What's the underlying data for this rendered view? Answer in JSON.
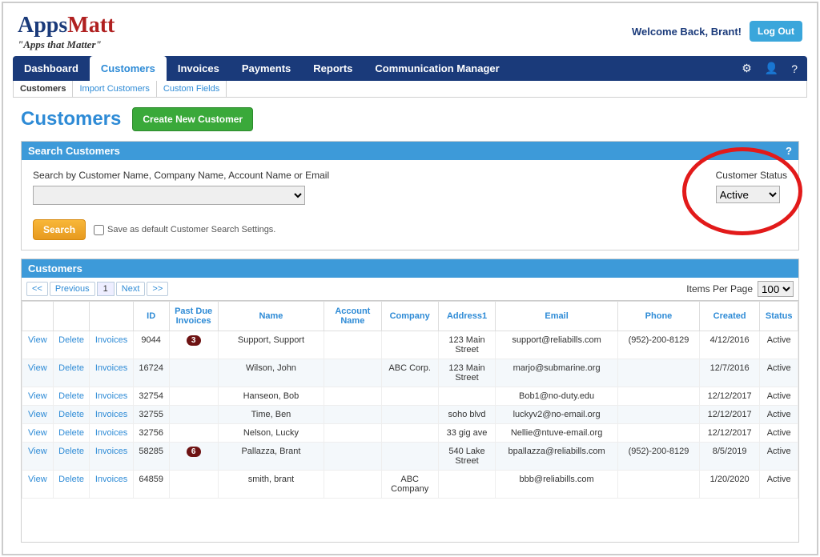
{
  "brand": {
    "apps": "Apps",
    "matt": "Matt",
    "tagline": "\"Apps that Matter\""
  },
  "header": {
    "welcome": "Welcome Back, Brant!",
    "logout": "Log Out"
  },
  "nav": {
    "items": [
      "Dashboard",
      "Customers",
      "Invoices",
      "Payments",
      "Reports",
      "Communication Manager"
    ],
    "active_index": 1
  },
  "subnav": {
    "items": [
      "Customers",
      "Import Customers",
      "Custom Fields"
    ],
    "active_index": 0
  },
  "page": {
    "title": "Customers",
    "create_btn": "Create New Customer"
  },
  "search_panel": {
    "title": "Search Customers",
    "help": "?",
    "field_label": "Search by Customer Name, Company Name, Account Name or Email",
    "status_label": "Customer Status",
    "status_value": "Active",
    "search_btn": "Search",
    "save_default": "Save as default Customer Search Settings."
  },
  "list_panel": {
    "title": "Customers",
    "pager": {
      "first": "<<",
      "prev": "Previous",
      "page": "1",
      "next": "Next",
      "last": ">>"
    },
    "items_per_page_label": "Items Per Page",
    "items_per_page_value": "100",
    "columns": [
      "",
      "",
      "",
      "ID",
      "Past Due Invoices",
      "Name",
      "Account Name",
      "Company",
      "Address1",
      "Email",
      "Phone",
      "Created",
      "Status"
    ],
    "action_labels": {
      "view": "View",
      "delete": "Delete",
      "invoices": "Invoices"
    },
    "rows": [
      {
        "id": "9044",
        "past_due": "3",
        "name": "Support, Support",
        "account": "",
        "company": "",
        "address": "123 Main Street",
        "email": "support@reliabills.com",
        "phone": "(952)-200-8129",
        "created": "4/12/2016",
        "status": "Active"
      },
      {
        "id": "16724",
        "past_due": "",
        "name": "Wilson, John",
        "account": "",
        "company": "ABC Corp.",
        "address": "123 Main Street",
        "email": "marjo@submarine.org",
        "phone": "",
        "created": "12/7/2016",
        "status": "Active"
      },
      {
        "id": "32754",
        "past_due": "",
        "name": "Hanseon, Bob",
        "account": "",
        "company": "",
        "address": "",
        "email": "Bob1@no-duty.edu",
        "phone": "",
        "created": "12/12/2017",
        "status": "Active"
      },
      {
        "id": "32755",
        "past_due": "",
        "name": "Time, Ben",
        "account": "",
        "company": "",
        "address": "soho blvd",
        "email": "luckyv2@no-email.org",
        "phone": "",
        "created": "12/12/2017",
        "status": "Active"
      },
      {
        "id": "32756",
        "past_due": "",
        "name": "Nelson, Lucky",
        "account": "",
        "company": "",
        "address": "33 gig ave",
        "email": "Nellie@ntuve-email.org",
        "phone": "",
        "created": "12/12/2017",
        "status": "Active"
      },
      {
        "id": "58285",
        "past_due": "6",
        "name": "Pallazza, Brant",
        "account": "",
        "company": "",
        "address": "540 Lake Street",
        "email": "bpallazza@reliabills.com",
        "phone": "(952)-200-8129",
        "created": "8/5/2019",
        "status": "Active"
      },
      {
        "id": "64859",
        "past_due": "",
        "name": "smith, brant",
        "account": "",
        "company": "ABC Company",
        "address": "",
        "email": "bbb@reliabills.com",
        "phone": "",
        "created": "1/20/2020",
        "status": "Active"
      }
    ]
  }
}
